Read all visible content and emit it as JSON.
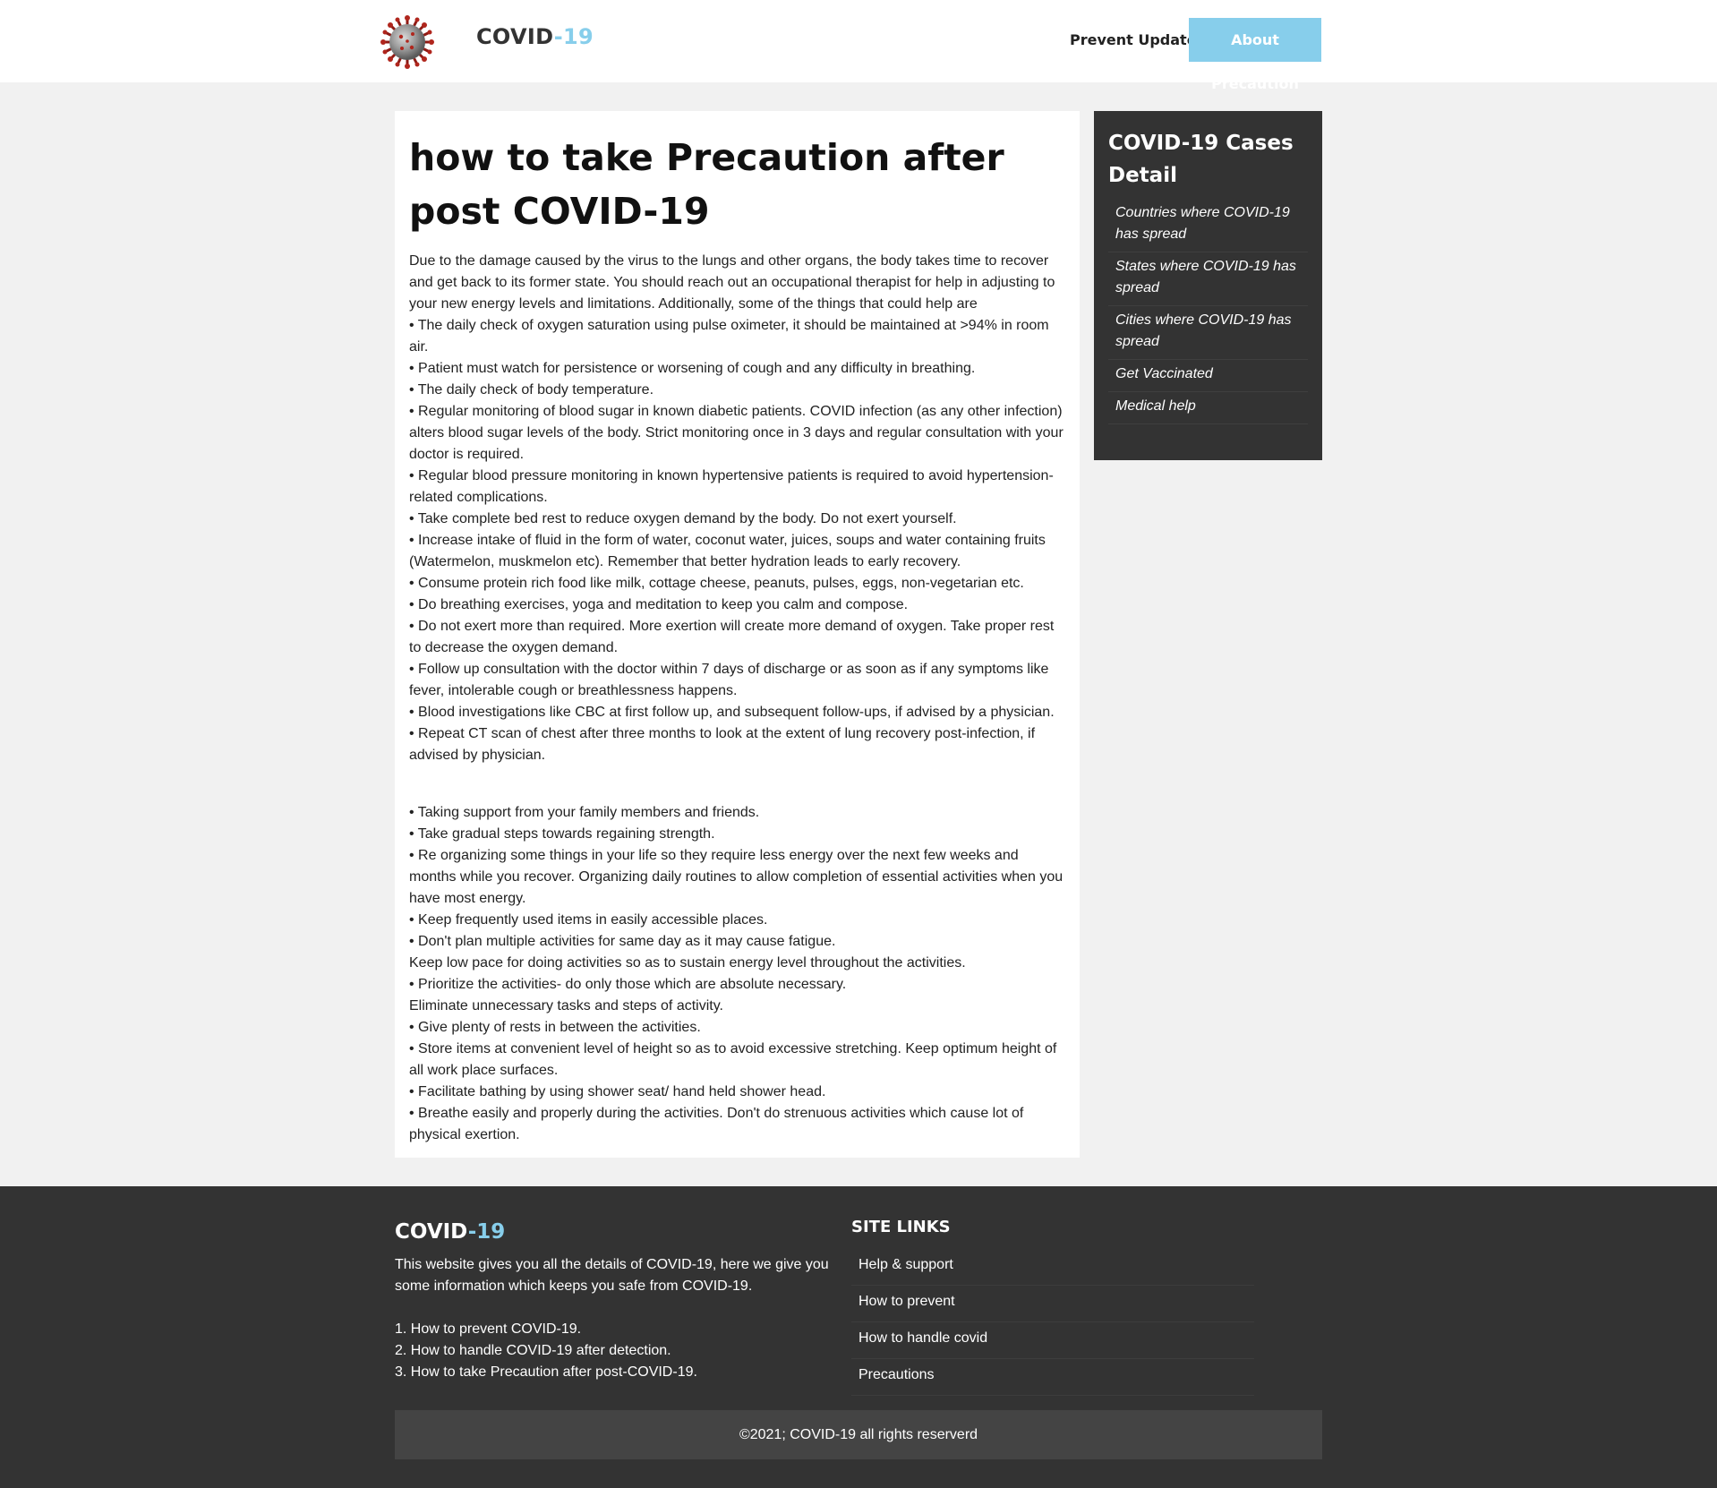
{
  "header": {
    "brand_main": "COVID",
    "brand_accent": "-19",
    "nav": {
      "prevent_update": "Prevent Update",
      "about_precaution": "About Precaution"
    }
  },
  "article": {
    "title": "how to take Precaution after post COVID-19",
    "paragraphs_part1": [
      "Due to the damage caused by the virus to the lungs and other organs, the body takes time to recover and get back to its former state. You should reach out an occupational therapist for help in adjusting to your new energy levels and limitations. Additionally, some of the things that could help are",
      "• The daily check of oxygen saturation using pulse oximeter, it should be maintained at >94% in room air.",
      "• Patient must watch for persistence or worsening of cough and any difficulty in breathing.",
      "• The daily check of body temperature.",
      "• Regular monitoring of blood sugar in known diabetic patients. COVID infection (as any other infection) alters blood sugar levels of the body. Strict monitoring once in 3 days and regular consultation with your doctor is required.",
      "• Regular blood pressure monitoring in known hypertensive patients is required to avoid hypertension-related complications.",
      "• Take complete bed rest to reduce oxygen demand by the body. Do not exert yourself.",
      "• Increase intake of fluid in the form of water, coconut water, juices, soups and water containing fruits (Watermelon, muskmelon etc). Remember that better hydration leads to early recovery.",
      "• Consume protein rich food like milk, cottage cheese, peanuts, pulses, eggs, non-vegetarian etc.",
      "• Do breathing exercises, yoga and meditation to keep you calm and compose.",
      "• Do not exert more than required. More exertion will create more demand of oxygen. Take proper rest to decrease the oxygen demand.",
      "• Follow up consultation with the doctor within 7 days of discharge or as soon as if any symptoms like fever, intolerable cough or breathlessness happens.",
      "• Blood investigations like CBC at first follow up, and subsequent follow-ups, if advised by a physician.",
      "• Repeat CT scan of chest after three months to look at the extent of lung recovery post-infection, if advised by physician."
    ],
    "paragraphs_part2": [
      "• Taking support from your family members and friends.",
      "• Take gradual steps towards regaining strength.",
      "• Re organizing some things in your life so they require less energy over the next few weeks and months while you recover. Organizing daily routines to allow completion of essential activities when you have most energy.",
      "• Keep frequently used items in easily accessible places.",
      "• Don't plan multiple activities for same day as it may cause fatigue.",
      "Keep low pace for doing activities so as to sustain energy level throughout the activities.",
      "• Prioritize the activities- do only those which are absolute necessary.",
      "Eliminate unnecessary tasks and steps of activity.",
      "• Give plenty of rests in between the activities.",
      "• Store items at convenient level of height so as to avoid excessive stretching. Keep optimum height of all work place surfaces.",
      "• Facilitate bathing by using shower seat/ hand held shower head.",
      "• Breathe easily and properly during the activities. Don't do strenuous activities which cause lot of physical exertion."
    ]
  },
  "sidebar": {
    "title": "COVID-19 Cases Detail",
    "items": [
      "Countries where COVID-19 has spread",
      "States where COVID-19 has spread",
      "Cities where COVID-19 has spread",
      "Get Vaccinated",
      "Medical help"
    ]
  },
  "footer": {
    "brand_main": "COVID",
    "brand_accent": "-19",
    "description": "This website gives you all the details of COVID-19, here we give you some information which keeps you safe from COVID-19.",
    "list": [
      "1. How to prevent COVID-19.",
      "2. How to handle COVID-19 after detection.",
      "3. How to take Precaution after post-COVID-19."
    ],
    "site_links_title": "SITE LINKS",
    "site_links": [
      "Help & support",
      "How to prevent",
      "How to handle covid",
      "Precautions"
    ],
    "copyright": "©2021; COVID-19 all rights reserverd"
  },
  "colors": {
    "accent": "#87ceeb",
    "dark_panel": "#333333",
    "page_bg": "#f1f1f1"
  },
  "icons": {
    "logo": "coronavirus-icon"
  }
}
